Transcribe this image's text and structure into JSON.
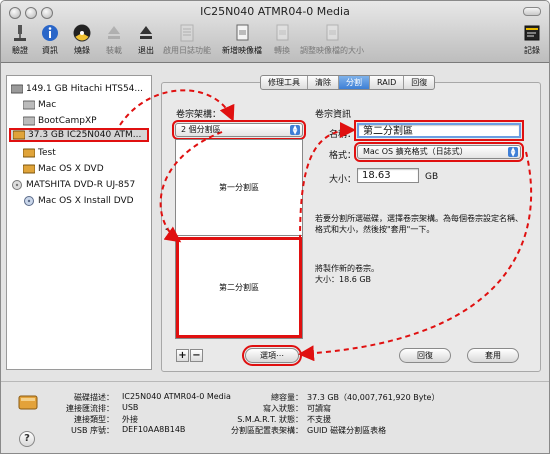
{
  "window": {
    "title": "IC25N040 ATMR04-0 Media"
  },
  "toolbar": {
    "items": [
      {
        "label": "驗證",
        "icon": "microscope-icon",
        "enabled": true
      },
      {
        "label": "資訊",
        "icon": "info-icon",
        "enabled": true
      },
      {
        "label": "燒錄",
        "icon": "burn-icon",
        "enabled": true
      },
      {
        "label": "裝載",
        "icon": "mount-icon",
        "enabled": false
      },
      {
        "label": "退出",
        "icon": "eject-icon",
        "enabled": true
      },
      {
        "label": "啟用日誌功能",
        "icon": "journal-icon",
        "enabled": false
      },
      {
        "label": "新增映像檔",
        "icon": "new-image-icon",
        "enabled": true
      },
      {
        "label": "轉換",
        "icon": "convert-icon",
        "enabled": false
      },
      {
        "label": "調整映像檔的大小",
        "icon": "resize-image-icon",
        "enabled": false
      },
      {
        "label": "記錄",
        "icon": "log-icon",
        "enabled": true
      }
    ]
  },
  "sidebar": {
    "devices": [
      {
        "label": "149.1 GB Hitachi HTS54...",
        "level": 0,
        "icon": "hard-disk-icon"
      },
      {
        "label": "Mac",
        "level": 1,
        "icon": "volume-icon"
      },
      {
        "label": "BootCampXP",
        "level": 1,
        "icon": "volume-icon"
      },
      {
        "label": "37.3 GB IC25N040 ATM...",
        "level": 0,
        "icon": "firewire-disk-icon",
        "selected": true
      },
      {
        "label": "Test",
        "level": 1,
        "icon": "volume-icon"
      },
      {
        "label": "Mac OS X DVD",
        "level": 1,
        "icon": "volume-icon"
      },
      {
        "label": "MATSHITA DVD-R UJ-857",
        "level": 0,
        "icon": "optical-drive-icon"
      },
      {
        "label": "Mac OS X Install DVD",
        "level": 1,
        "icon": "dvd-icon"
      }
    ]
  },
  "tabs": [
    {
      "label": "修理工具",
      "active": false
    },
    {
      "label": "清除",
      "active": false
    },
    {
      "label": "分割",
      "active": true
    },
    {
      "label": "RAID",
      "active": false
    },
    {
      "label": "回復",
      "active": false
    }
  ],
  "partition": {
    "scheme_label": "卷宗架構：",
    "scheme_value": "2 個分割區",
    "part1_label": "第一分割區",
    "part2_label": "第二分割區",
    "info_title": "卷宗資訊",
    "name_label": "名稱：",
    "name_value": "第二分割區",
    "format_label": "格式：",
    "format_value": "Mac OS 擴充格式（日誌式）",
    "size_label": "大小：",
    "size_value": "18.63",
    "size_unit": "GB",
    "help_text": "若要分割所選磁碟，選擇卷宗架構。為每個卷宗設定名稱、格式和大小，然後按\"套用\"一下。",
    "status_text": "將製作新的卷宗。",
    "status_size": "大小：18.6 GB",
    "add_btn": "+",
    "remove_btn": "−",
    "options_btn": "選項⋯",
    "revert_btn": "回復",
    "apply_btn": "套用"
  },
  "info": {
    "left": [
      {
        "key": "磁碟描述：",
        "value": "IC25N040 ATMR04-0 Media"
      },
      {
        "key": "連接匯流排：",
        "value": "USB"
      },
      {
        "key": "連接類型：",
        "value": "外接"
      },
      {
        "key": "USB 序號：",
        "value": "DEF10AA8B14B"
      }
    ],
    "right": [
      {
        "key": "總容量：",
        "value": "37.3 GB（40,007,761,920 Byte）"
      },
      {
        "key": "寫入狀態：",
        "value": "可讀寫"
      },
      {
        "key": "S.M.A.R.T. 狀態：",
        "value": "不支援"
      },
      {
        "key": "分割區配置表架構：",
        "value": "GUID 磁碟分割區表格"
      }
    ],
    "help_label": "?"
  },
  "colors": {
    "annotation": "#e01010",
    "selection_blue": "#3d7fd6"
  }
}
